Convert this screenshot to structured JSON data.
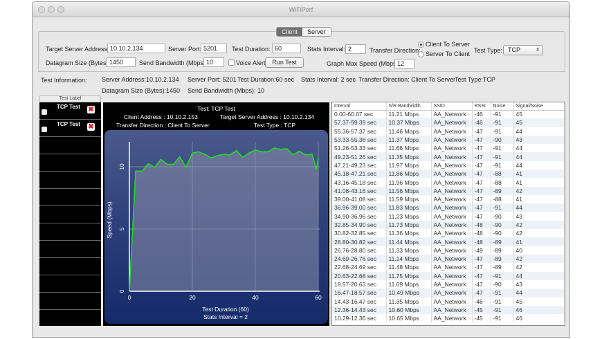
{
  "window": {
    "title": "WiFiPerf"
  },
  "tabs": [
    {
      "label": "Client",
      "active": true
    },
    {
      "label": "Server",
      "active": false
    }
  ],
  "form": {
    "target_server_label": "Target Server Address:",
    "target_server": "10.10.2.134",
    "server_port_label": "Server Port:",
    "server_port": "5201",
    "test_duration_label": "Test Duration:",
    "test_duration": "60",
    "stats_interval_label": "Stats Interval:",
    "stats_interval": "2",
    "transfer_direction_label": "Transfer Direction:",
    "direction_options": [
      "Client To Server",
      "Server To Client"
    ],
    "direction_selected": "Client To Server",
    "test_type_label": "Test Type:",
    "test_type": "TCP",
    "datagram_label": "Datagram Size (Bytes):",
    "datagram": "1450",
    "send_bw_label": "Send Bandwidth (Mbps):",
    "send_bw": "10",
    "voice_alert_label": "Voice Alert",
    "voice_alert": false,
    "run_test": "Run Test",
    "graph_max_label": "Graph Max Speed (Mbps):",
    "graph_max": "12"
  },
  "info": {
    "label": "Test Information:",
    "server_address": "Server Address:10.10.2.134",
    "server_port": "Server Port: 5201",
    "test_duration": "Test Duration:60 sec",
    "stats_interval": "Stats Interval: 2 sec",
    "transfer_direction": "Transfer Direction: Client To Server",
    "test_type": "Test Type:TCP",
    "datagram": "Datagram Size (Bytes):1450",
    "send_bw": "Send Bandwidth (Mbps): 10"
  },
  "tests": {
    "header": "Test Label",
    "items": [
      {
        "label": "TCP Test"
      },
      {
        "label": "TCP Test"
      }
    ]
  },
  "chart_header": {
    "title": "Test: TCP Test",
    "client": "Client Address : 10.10.2.153",
    "target": "Target Server Address : 10.10.2.134",
    "direction": "Transfer Direction : Client To Server",
    "type": "Test Type : TCP"
  },
  "chart_data": {
    "type": "area",
    "xlabel": "Test Duration (60)",
    "xlabel2": "Stats Interval = 2",
    "ylabel": "Speed (Mbps)",
    "xlim": [
      0,
      60
    ],
    "ylim": [
      0,
      12
    ],
    "xticks": [
      "0",
      "20",
      "40",
      "60"
    ],
    "yticks": [
      "0",
      "5",
      "10"
    ],
    "grid": true,
    "line_color": "#22dd22",
    "x": [
      0,
      2,
      4,
      6,
      8,
      10,
      12,
      14,
      16,
      18,
      20,
      22,
      24,
      26,
      28,
      30,
      32,
      34,
      36,
      38,
      40,
      42,
      44,
      46,
      48,
      50,
      52,
      54,
      56,
      58,
      59.4,
      60
    ],
    "y": [
      0,
      9.65,
      9.65,
      10.25,
      9.95,
      10.6,
      10.2,
      10.2,
      10.8,
      9.95,
      11.1,
      11.2,
      11.0,
      10.7,
      10.9,
      11.0,
      10.95,
      11.3,
      10.75,
      11.1,
      11.35,
      11.2,
      11.2,
      11.5,
      11.4,
      11.45,
      10.95,
      11.25,
      10.95,
      11.0,
      9.8,
      10.7
    ]
  },
  "table": {
    "columns": [
      "Interval",
      "S/R Bandwidth",
      "SSID",
      "RSSI",
      "Noise",
      "Signal/Noise"
    ],
    "rows": [
      [
        "0.00-60.07 sec",
        "11.21 Mbps",
        "AA_Network",
        "-46",
        "-91",
        "45"
      ],
      [
        "57.37-59.39 sec",
        "10.37 Mbps",
        "AA_Network",
        "-46",
        "-91",
        "45"
      ],
      [
        "55.36-57.37 sec",
        "11.46 Mbps",
        "AA_Network",
        "-47",
        "-91",
        "44"
      ],
      [
        "53.33-55.36 sec",
        "11.37 Mbps",
        "AA_Network",
        "-47",
        "-90",
        "43"
      ],
      [
        "51.26-53.33 sec",
        "11.66 Mbps",
        "AA_Network",
        "-47",
        "-91",
        "44"
      ],
      [
        "49.23-51.26 sec",
        "11.35 Mbps",
        "AA_Network",
        "-47",
        "-91",
        "44"
      ],
      [
        "47.21-49.23 sec",
        "11.97 Mbps",
        "AA_Network",
        "-47",
        "-91",
        "44"
      ],
      [
        "45.18-47.21 sec",
        "11.86 Mbps",
        "AA_Network",
        "-47",
        "-88",
        "41"
      ],
      [
        "43.16-45.18 sec",
        "11.96 Mbps",
        "AA_Network",
        "-47",
        "-88",
        "41"
      ],
      [
        "41.08-43.16 sec",
        "11.56 Mbps",
        "AA_Network",
        "-47",
        "-89",
        "42"
      ],
      [
        "39.00-41.08 sec",
        "11.59 Mbps",
        "AA_Network",
        "-47",
        "-88",
        "41"
      ],
      [
        "36.96-39.00 sec",
        "11.83 Mbps",
        "AA_Network",
        "-47",
        "-91",
        "44"
      ],
      [
        "34.90-36.96 sec",
        "11.23 Mbps",
        "AA_Network",
        "-47",
        "-90",
        "43"
      ],
      [
        "32.85-34.90 sec",
        "11.73 Mbps",
        "AA_Network",
        "-48",
        "-90",
        "42"
      ],
      [
        "30.82-32.85 sec",
        "11.36 Mbps",
        "AA_Network",
        "-48",
        "-90",
        "42"
      ],
      [
        "28.80-30.82 sec",
        "11.44 Mbps",
        "AA_Network",
        "-48",
        "-89",
        "41"
      ],
      [
        "26.76-28.80 sec",
        "11.33 Mbps",
        "AA_Network",
        "-49",
        "-89",
        "40"
      ],
      [
        "24.69-26.76 sec",
        "11.14 Mbps",
        "AA_Network",
        "-47",
        "-89",
        "42"
      ],
      [
        "22.68-24.69 sec",
        "11.48 Mbps",
        "AA_Network",
        "-47",
        "-89",
        "42"
      ],
      [
        "20.63-22.68 sec",
        "11.75 Mbps",
        "AA_Network",
        "-47",
        "-91",
        "44"
      ],
      [
        "18.57-20.63 sec",
        "11.69 Mbps",
        "AA_Network",
        "-47",
        "-90",
        "43"
      ],
      [
        "16.47-18.57 sec",
        "10.49 Mbps",
        "AA_Network",
        "-47",
        "-91",
        "44"
      ],
      [
        "14.43-16.47 sec",
        "11.35 Mbps",
        "AA_Network",
        "-46",
        "-91",
        "45"
      ],
      [
        "12.36-14.43 sec",
        "10.60 Mbps",
        "AA_Network",
        "-45",
        "-91",
        "46"
      ],
      [
        "10.29-12.36 sec",
        "10.65 Mbps",
        "AA_Network",
        "-45",
        "-91",
        "46"
      ]
    ]
  }
}
